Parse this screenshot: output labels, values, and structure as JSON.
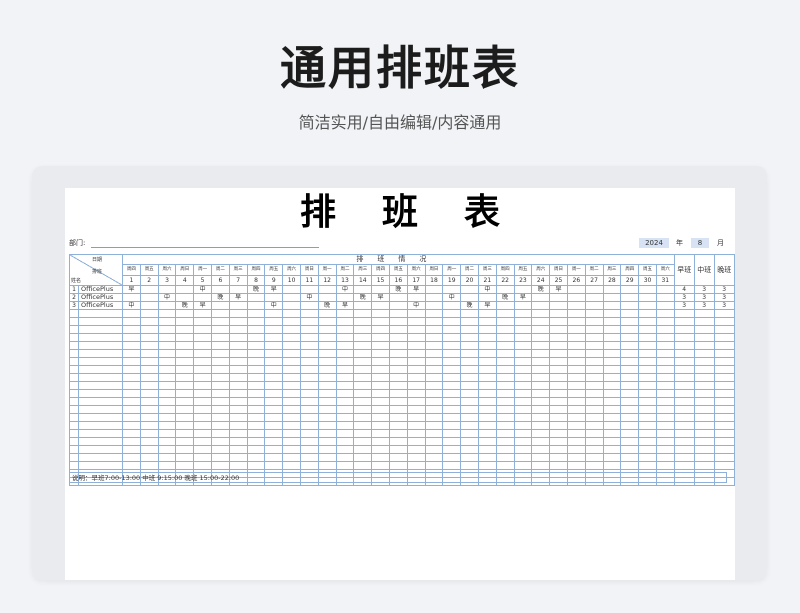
{
  "page": {
    "title": "通用排班表",
    "subtitle": "简洁实用/自由编辑/内容通用"
  },
  "sheet": {
    "title": "排班表",
    "dept_label": "部门:",
    "year": "2024",
    "year_unit": "年",
    "month": "8",
    "month_unit": "月",
    "header": {
      "date_label": "日期",
      "shift_label": "排班",
      "name_label": "姓名",
      "group_title": "排班情况",
      "summary": [
        "早班",
        "中班",
        "晚班"
      ]
    },
    "weekdays": [
      "周四",
      "周五",
      "周六",
      "周日",
      "周一",
      "周二",
      "周三",
      "周四",
      "周五",
      "周六",
      "周日",
      "周一",
      "周二",
      "周三",
      "周四",
      "周五",
      "周六",
      "周日",
      "周一",
      "周二",
      "周三",
      "周四",
      "周五",
      "周六",
      "周日",
      "周一",
      "周二",
      "周三",
      "周四",
      "周五",
      "周六"
    ],
    "days": [
      "1",
      "2",
      "3",
      "4",
      "5",
      "6",
      "7",
      "8",
      "9",
      "10",
      "11",
      "12",
      "13",
      "14",
      "15",
      "16",
      "17",
      "18",
      "19",
      "20",
      "21",
      "22",
      "23",
      "24",
      "25",
      "26",
      "27",
      "28",
      "29",
      "30",
      "31"
    ],
    "rows": [
      {
        "no": "1",
        "name": "OfficePlus",
        "shifts": [
          "早",
          "",
          "",
          "",
          "中",
          "",
          "",
          "晚",
          "早",
          "",
          "",
          "",
          "中",
          "",
          "",
          "晚",
          "早",
          "",
          "",
          "",
          "中",
          "",
          "",
          "晚",
          "早",
          "",
          "",
          "",
          "",
          "",
          ""
        ],
        "counts": [
          "4",
          "3",
          "3"
        ]
      },
      {
        "no": "2",
        "name": "OfficePlus",
        "shifts": [
          "",
          "",
          "中",
          "",
          "",
          "晚",
          "早",
          "",
          "",
          "",
          "中",
          "",
          "",
          "晚",
          "早",
          "",
          "",
          "",
          "中",
          "",
          "",
          "晚",
          "早",
          "",
          "",
          "",
          "",
          "",
          "",
          "",
          ""
        ],
        "counts": [
          "3",
          "3",
          "3"
        ]
      },
      {
        "no": "3",
        "name": "OfficePlus",
        "shifts": [
          "中",
          "",
          "",
          "晚",
          "早",
          "",
          "",
          "",
          "中",
          "",
          "",
          "晚",
          "早",
          "",
          "",
          "",
          "中",
          "",
          "",
          "晚",
          "早",
          "",
          "",
          "",
          "",
          "",
          "",
          "",
          "",
          "",
          ""
        ],
        "counts": [
          "3",
          "3",
          "3"
        ]
      }
    ],
    "empty_rows": 22,
    "note": "说明：早班7:00-13:00  中班 9:15:00  晚班 15:00-22:00"
  },
  "colors": {
    "grid": "#8fb0d8",
    "highlight": "#d7e3f4",
    "background": "#f1f3f6"
  }
}
